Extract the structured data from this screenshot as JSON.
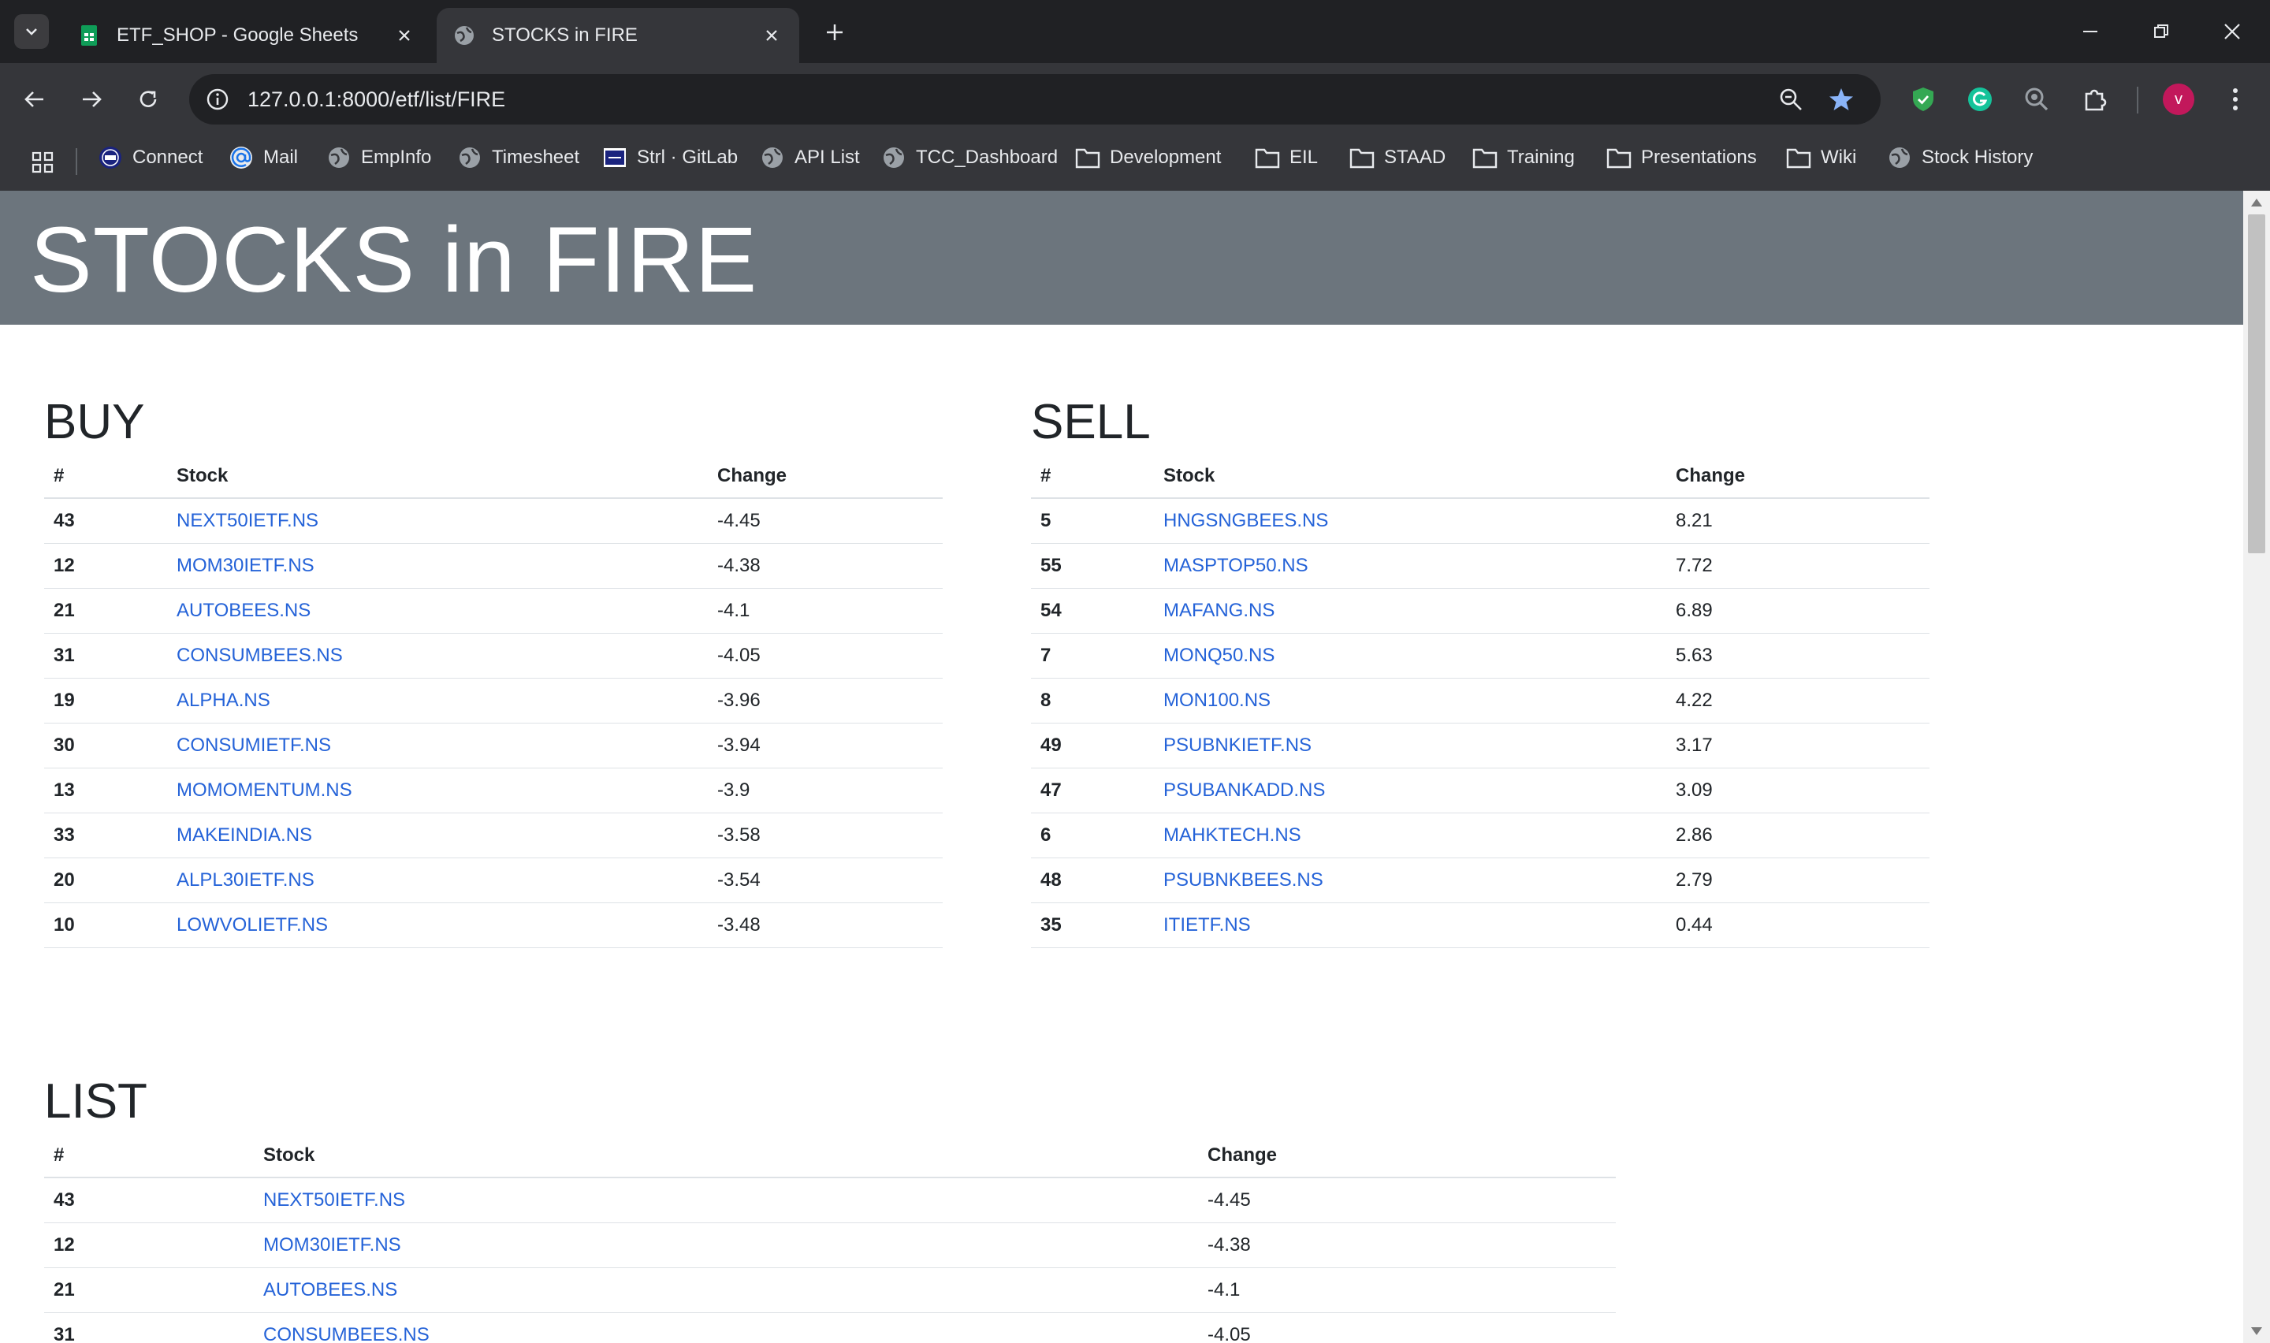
{
  "browser": {
    "tabs": [
      {
        "title": "ETF_SHOP - Google Sheets",
        "active": false,
        "icon": "google-sheets-icon"
      },
      {
        "title": "STOCKS in FIRE",
        "active": true,
        "icon": "globe-icon"
      }
    ],
    "url": "127.0.0.1:8000/etf/list/FIRE",
    "avatar_letter": "v",
    "bookmarks": [
      {
        "label": "Connect",
        "icon": "eil-logo-icon"
      },
      {
        "label": "Mail",
        "icon": "at-sign-icon"
      },
      {
        "label": "EmpInfo",
        "icon": "globe-icon"
      },
      {
        "label": "Timesheet",
        "icon": "globe-icon"
      },
      {
        "label": "Strl · GitLab",
        "icon": "gitlab-icon"
      },
      {
        "label": "API List",
        "icon": "globe-icon"
      },
      {
        "label": "TCC_Dashboard",
        "icon": "globe-icon"
      },
      {
        "label": "Development",
        "icon": "folder-icon"
      },
      {
        "label": "EIL",
        "icon": "folder-icon"
      },
      {
        "label": "STAAD",
        "icon": "folder-icon"
      },
      {
        "label": "Training",
        "icon": "folder-icon"
      },
      {
        "label": "Presentations",
        "icon": "folder-icon"
      },
      {
        "label": "Wiki",
        "icon": "folder-icon"
      },
      {
        "label": "Stock History",
        "icon": "globe-icon"
      }
    ]
  },
  "page": {
    "title": "STOCKS in FIRE",
    "buy": {
      "heading": "BUY",
      "columns": [
        "#",
        "Stock",
        "Change"
      ],
      "rows": [
        {
          "num": "43",
          "stock": "NEXT50IETF.NS",
          "change": "-4.45"
        },
        {
          "num": "12",
          "stock": "MOM30IETF.NS",
          "change": "-4.38"
        },
        {
          "num": "21",
          "stock": "AUTOBEES.NS",
          "change": "-4.1"
        },
        {
          "num": "31",
          "stock": "CONSUMBEES.NS",
          "change": "-4.05"
        },
        {
          "num": "19",
          "stock": "ALPHA.NS",
          "change": "-3.96"
        },
        {
          "num": "30",
          "stock": "CONSUMIETF.NS",
          "change": "-3.94"
        },
        {
          "num": "13",
          "stock": "MOMOMENTUM.NS",
          "change": "-3.9"
        },
        {
          "num": "33",
          "stock": "MAKEINDIA.NS",
          "change": "-3.58"
        },
        {
          "num": "20",
          "stock": "ALPL30IETF.NS",
          "change": "-3.54"
        },
        {
          "num": "10",
          "stock": "LOWVOLIETF.NS",
          "change": "-3.48"
        }
      ]
    },
    "sell": {
      "heading": "SELL",
      "columns": [
        "#",
        "Stock",
        "Change"
      ],
      "rows": [
        {
          "num": "5",
          "stock": "HNGSNGBEES.NS",
          "change": "8.21"
        },
        {
          "num": "55",
          "stock": "MASPTOP50.NS",
          "change": "7.72"
        },
        {
          "num": "54",
          "stock": "MAFANG.NS",
          "change": "6.89"
        },
        {
          "num": "7",
          "stock": "MONQ50.NS",
          "change": "5.63"
        },
        {
          "num": "8",
          "stock": "MON100.NS",
          "change": "4.22"
        },
        {
          "num": "49",
          "stock": "PSUBNKIETF.NS",
          "change": "3.17"
        },
        {
          "num": "47",
          "stock": "PSUBANKADD.NS",
          "change": "3.09"
        },
        {
          "num": "6",
          "stock": "MAHKTECH.NS",
          "change": "2.86"
        },
        {
          "num": "48",
          "stock": "PSUBNKBEES.NS",
          "change": "2.79"
        },
        {
          "num": "35",
          "stock": "ITIETF.NS",
          "change": "0.44"
        }
      ]
    },
    "list": {
      "heading": "LIST",
      "columns": [
        "#",
        "Stock",
        "Change"
      ],
      "rows": [
        {
          "num": "43",
          "stock": "NEXT50IETF.NS",
          "change": "-4.45"
        },
        {
          "num": "12",
          "stock": "MOM30IETF.NS",
          "change": "-4.38"
        },
        {
          "num": "21",
          "stock": "AUTOBEES.NS",
          "change": "-4.1"
        },
        {
          "num": "31",
          "stock": "CONSUMBEES.NS",
          "change": "-4.05"
        }
      ]
    }
  },
  "colors": {
    "hero_bg": "#6c757d",
    "link": "#2563d8",
    "chrome_dark": "#202124",
    "chrome_mid": "#35363a"
  }
}
